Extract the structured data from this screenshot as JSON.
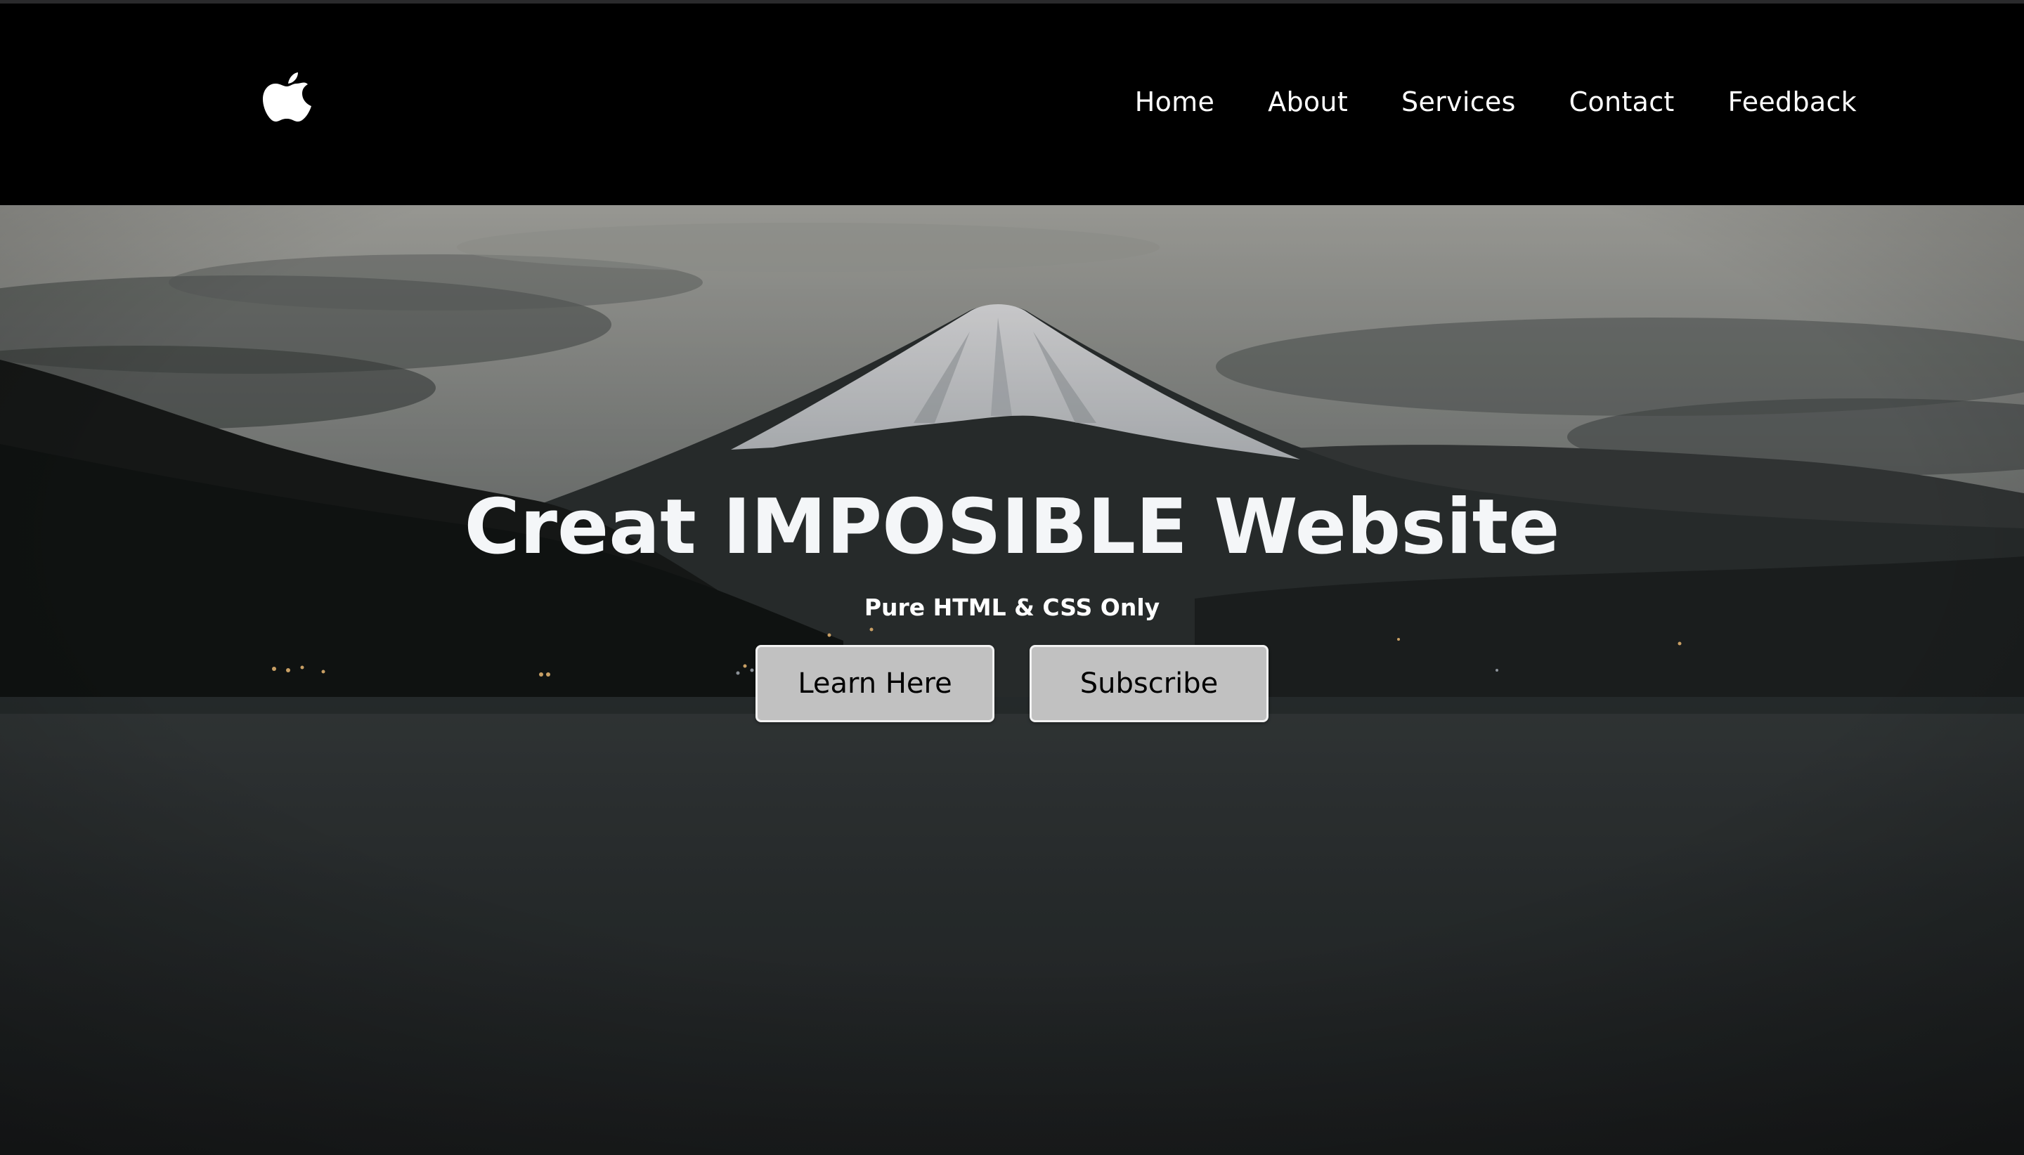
{
  "navbar": {
    "logo_icon": "apple-logo-icon",
    "links": [
      {
        "label": "Home"
      },
      {
        "label": "About"
      },
      {
        "label": "Services"
      },
      {
        "label": "Contact"
      },
      {
        "label": "Feedback"
      }
    ]
  },
  "hero": {
    "background_icon": "mountain-lake-landscape-image",
    "title": "Creat IMPOSIBLE Website",
    "subtitle": "Pure HTML & CSS Only",
    "buttons": [
      {
        "label": "Learn Here"
      },
      {
        "label": "Subscribe"
      }
    ]
  },
  "colors": {
    "navbar_bg": "#000000",
    "title_text": "#f4f6f8",
    "button_bg": "#c1c1c1",
    "button_border": "#f2f2f2"
  }
}
